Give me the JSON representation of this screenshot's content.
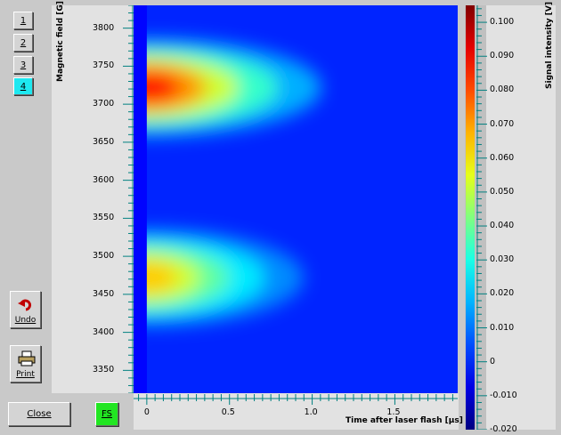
{
  "page_buttons": [
    "1",
    "2",
    "3",
    "4"
  ],
  "active_page": "4",
  "buttons": {
    "undo": "Undo",
    "print": "Print",
    "close": "Close",
    "fs": "FS"
  },
  "colors": {
    "active_page_bg": "#1ee8f0",
    "fs_bg": "#22e622"
  },
  "chart_data": {
    "type": "heatmap",
    "xlabel": "Time after laser flash [μs]",
    "ylabel": "Magnetic field [G]",
    "colorbar_label": "Signal intensity [V]",
    "x_ticks": [
      "0",
      "0.5",
      "1.0",
      "1.5"
    ],
    "x_tick_values": [
      0,
      0.5,
      1.0,
      1.5
    ],
    "y_ticks": [
      "3800",
      "3750",
      "3700",
      "3650",
      "3600",
      "3550",
      "3500",
      "3450",
      "3400",
      "3350"
    ],
    "y_tick_values": [
      3800,
      3750,
      3700,
      3650,
      3600,
      3550,
      3500,
      3450,
      3400,
      3350
    ],
    "colorbar_ticks": [
      "0.100",
      "0.090",
      "0.080",
      "0.070",
      "0.060",
      "0.050",
      "0.040",
      "0.030",
      "0.020",
      "0.010",
      "0",
      "-0.010",
      "-0.020"
    ],
    "colorbar_tick_values": [
      0.1,
      0.09,
      0.08,
      0.07,
      0.06,
      0.05,
      0.04,
      0.03,
      0.02,
      0.01,
      0,
      -0.01,
      -0.02
    ],
    "xlim": [
      -0.08,
      1.88
    ],
    "ylim": [
      3320,
      3830
    ],
    "clim": [
      -0.02,
      0.105
    ],
    "signals": [
      {
        "center_field": 3722,
        "peak_intensity": 0.095
      },
      {
        "center_field": 3472,
        "peak_intensity": 0.07
      }
    ]
  }
}
